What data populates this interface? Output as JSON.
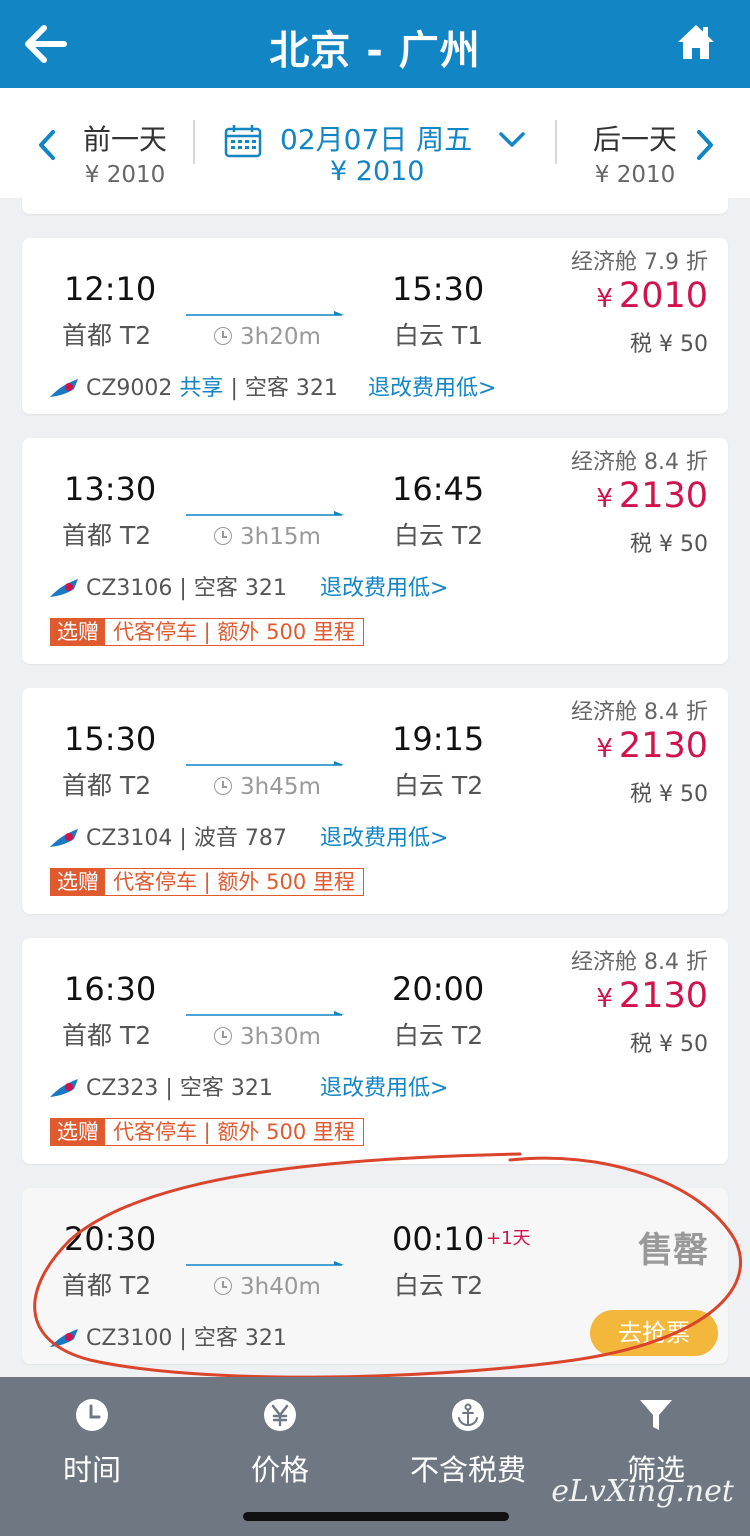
{
  "header": {
    "title": "北京 - 广州"
  },
  "datebar": {
    "prev": {
      "label": "前一天",
      "price": "¥ 2010"
    },
    "current": {
      "date": "02月07日 周五",
      "price": "¥ 2010"
    },
    "next": {
      "label": "后一天",
      "price": "¥ 2010"
    }
  },
  "flights": [
    {
      "dep_time": "12:10",
      "dep_airport": "首都 T2",
      "arr_time": "15:30",
      "arr_airport": "白云 T1",
      "duration": "3h20m",
      "cabin": "经济舱 7.9 折",
      "price": "2010",
      "tax": "税 ¥ 50",
      "flight_no": "CZ9002",
      "share": "共享",
      "aircraft": "| 空客 321",
      "refund": "退改费用低>"
    },
    {
      "dep_time": "13:30",
      "dep_airport": "首都 T2",
      "arr_time": "16:45",
      "arr_airport": "白云 T2",
      "duration": "3h15m",
      "cabin": "经济舱 8.4 折",
      "price": "2130",
      "tax": "税 ¥ 50",
      "flight_no": "CZ3106 |",
      "aircraft": "空客 321",
      "refund": "退改费用低>",
      "promo_tag": "选赠",
      "promo_text": "代客停车 | 额外 500 里程"
    },
    {
      "dep_time": "15:30",
      "dep_airport": "首都 T2",
      "arr_time": "19:15",
      "arr_airport": "白云 T2",
      "duration": "3h45m",
      "cabin": "经济舱 8.4 折",
      "price": "2130",
      "tax": "税 ¥ 50",
      "flight_no": "CZ3104 |",
      "aircraft": "波音 787",
      "refund": "退改费用低>",
      "promo_tag": "选赠",
      "promo_text": "代客停车 | 额外 500 里程"
    },
    {
      "dep_time": "16:30",
      "dep_airport": "首都 T2",
      "arr_time": "20:00",
      "arr_airport": "白云 T2",
      "duration": "3h30m",
      "cabin": "经济舱 8.4 折",
      "price": "2130",
      "tax": "税 ¥ 50",
      "flight_no": "CZ323 |",
      "aircraft": "空客 321",
      "refund": "退改费用低>",
      "promo_tag": "选赠",
      "promo_text": "代客停车 | 额外 500 里程"
    },
    {
      "dep_time": "20:30",
      "dep_airport": "首都 T2",
      "arr_time": "00:10",
      "arr_airport": "白云 T2",
      "next_day": "+1天",
      "duration": "3h40m",
      "flight_no": "CZ3100 |",
      "aircraft": "空客 321",
      "status": "售罄",
      "action": "去抢票"
    }
  ],
  "price_symbol": "¥",
  "bottom_tabs": [
    {
      "label": "时间",
      "icon": "clock-icon"
    },
    {
      "label": "价格",
      "icon": "yen-icon"
    },
    {
      "label": "不含税费",
      "icon": "anchor-icon"
    },
    {
      "label": "筛选",
      "icon": "filter-icon"
    }
  ],
  "watermark": "eLvXing.net",
  "colors": {
    "brand": "#1285c5",
    "price": "#d0134c",
    "promo": "#e05a30",
    "grab": "#f3b73c",
    "annotation": "#d9442b"
  }
}
